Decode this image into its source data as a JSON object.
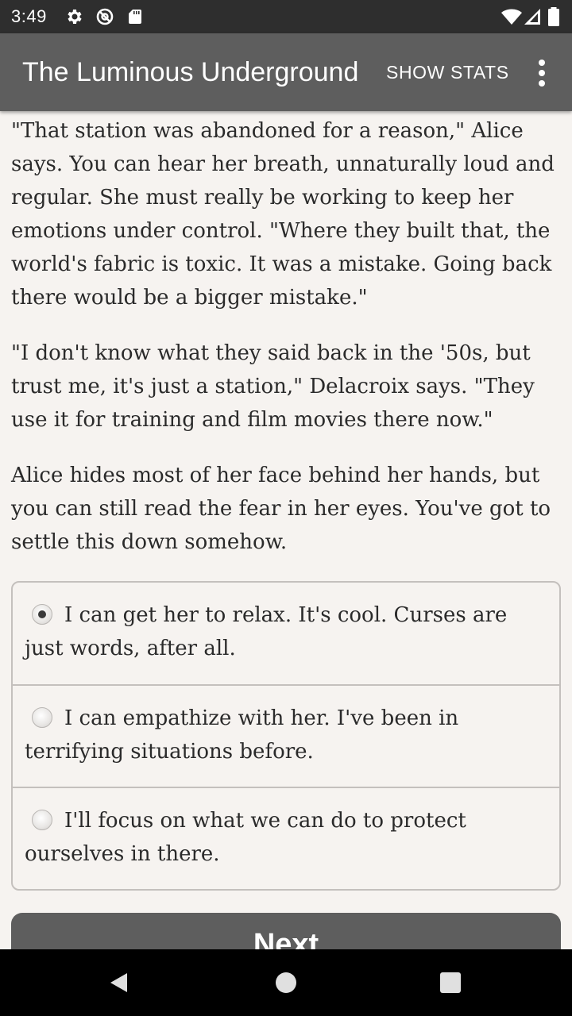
{
  "status_bar": {
    "time": "3:49",
    "left_icons": [
      "gear-icon",
      "no-sync-icon",
      "sd-card-icon"
    ],
    "right_icons": [
      "wifi-icon",
      "signal-icon",
      "battery-icon"
    ]
  },
  "app_bar": {
    "title": "The Luminous Underground",
    "show_stats_label": "SHOW STATS",
    "menu_icon": "more-vert-icon"
  },
  "story": {
    "paragraphs": [
      "\"That station was abandoned for a reason,\" Alice says. You can hear her breath, unnaturally loud and regular. She must really be working to keep her emotions under control. \"Where they built that, the world's fabric is toxic. It was a mistake. Going back there would be a bigger mistake.\"",
      "\"I don't know what they said back in the '50s, but trust me, it's just a station,\" Delacroix says. \"They use it for training and film movies there now.\"",
      "Alice hides most of her face behind her hands, but you can still read the fear in her eyes. You've got to settle this down somehow."
    ]
  },
  "choices": {
    "options": [
      {
        "label": "I can get her to relax. It's cool. Curses are just words, after all.",
        "selected": true
      },
      {
        "label": "I can empathize with her. I've been in terrifying situations before.",
        "selected": false
      },
      {
        "label": "I'll focus on what we can do to protect ourselves in there.",
        "selected": false
      }
    ]
  },
  "next_button": {
    "label": "Next"
  },
  "nav_bar": {
    "icons": [
      "back-icon",
      "home-icon",
      "recents-icon"
    ]
  },
  "colors": {
    "app_bar": "#5e5e5e",
    "status_bar": "#2e2e2e",
    "background": "#f6f3f0",
    "text": "#2a2a2a",
    "border": "#c4c0bd"
  }
}
